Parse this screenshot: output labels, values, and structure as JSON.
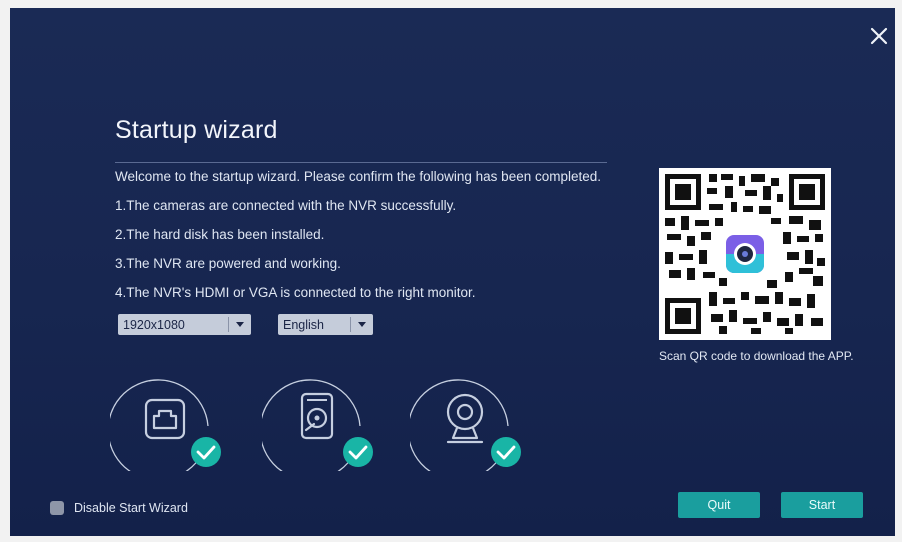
{
  "wizard": {
    "title": "Startup wizard",
    "intro": "Welcome to the startup wizard. Please confirm the following has been completed.",
    "items": [
      "1.The cameras are connected with the NVR successfully.",
      "2.The hard disk has been installed.",
      "3.The NVR are powered and working.",
      "4.The NVR's HDMI or VGA is connected to the right monitor."
    ],
    "resolution": "1920x1080",
    "language": "English",
    "qr_caption": "Scan QR code to download the APP.",
    "status_icons": [
      "network-icon",
      "hard-disk-icon",
      "camera-icon"
    ],
    "disable_label": "Disable Start Wizard",
    "quit_label": "Quit",
    "start_label": "Start"
  },
  "colors": {
    "background": "#172650",
    "accent": "#1a9e9e",
    "check": "#19b5a6"
  }
}
